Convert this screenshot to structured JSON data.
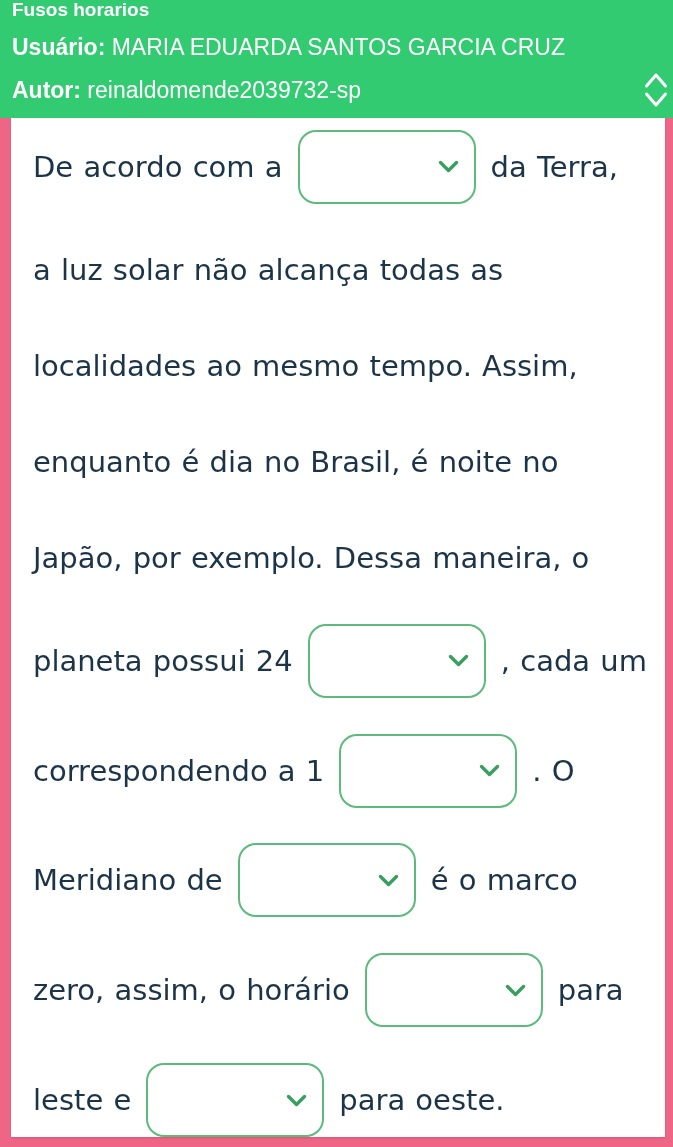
{
  "header": {
    "title": "Fusos horarios",
    "user": "**Usuário:** MARIA EDUARDA SANTOS GARCIA CRUZ",
    "author": "**Autor:** reinaldomende2039732-sp"
  },
  "passage": {
    "lines": [
      [
        {
          "kind": "text",
          "text": "De acordo com a"
        },
        {
          "kind": "select"
        },
        {
          "kind": "text",
          "text": "da Terra,"
        }
      ],
      [
        {
          "kind": "text",
          "text": "a luz solar não alcança todas as"
        }
      ],
      [
        {
          "kind": "text",
          "text": "localidades ao mesmo tempo. Assim,"
        }
      ],
      [
        {
          "kind": "text",
          "text": "enquanto é dia no Brasil, é noite no"
        }
      ],
      [
        {
          "kind": "text",
          "text": "Japão, por exemplo. Dessa maneira, o"
        }
      ],
      [
        {
          "kind": "text",
          "text": "planeta possui 24"
        },
        {
          "kind": "select"
        },
        {
          "kind": "text",
          "text": ", cada um"
        }
      ],
      [
        {
          "kind": "text",
          "text": "correspondendo a 1"
        },
        {
          "kind": "select"
        },
        {
          "kind": "text",
          "text": ". O"
        }
      ],
      [
        {
          "kind": "text",
          "text": "Meridiano de"
        },
        {
          "kind": "select"
        },
        {
          "kind": "text",
          "text": "é o marco"
        }
      ],
      [
        {
          "kind": "text",
          "text": "zero, assim, o horário"
        },
        {
          "kind": "select"
        },
        {
          "kind": "text",
          "text": "para"
        }
      ],
      [
        {
          "kind": "text",
          "text": "leste e"
        },
        {
          "kind": "select"
        },
        {
          "kind": "text",
          "text": "para oeste."
        }
      ]
    ]
  }
}
